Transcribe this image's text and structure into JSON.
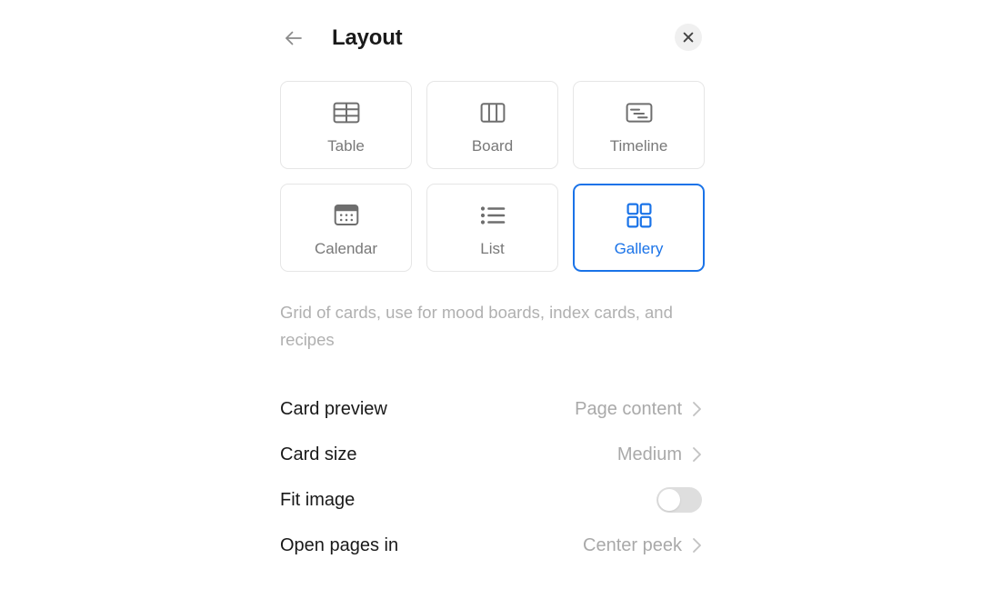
{
  "header": {
    "title": "Layout",
    "back_icon": "arrow-left-icon",
    "close_icon": "close-icon"
  },
  "layout_options": [
    {
      "label": "Table",
      "icon": "table-icon",
      "selected": false
    },
    {
      "label": "Board",
      "icon": "board-icon",
      "selected": false
    },
    {
      "label": "Timeline",
      "icon": "timeline-icon",
      "selected": false
    },
    {
      "label": "Calendar",
      "icon": "calendar-icon",
      "selected": false
    },
    {
      "label": "List",
      "icon": "list-icon",
      "selected": false
    },
    {
      "label": "Gallery",
      "icon": "gallery-icon",
      "selected": true
    }
  ],
  "description": "Grid of cards, use for mood boards, index cards, and recipes",
  "settings": [
    {
      "label": "Card preview",
      "value": "Page content",
      "type": "chevron"
    },
    {
      "label": "Card size",
      "value": "Medium",
      "type": "chevron"
    },
    {
      "label": "Fit image",
      "value": "off",
      "type": "toggle"
    },
    {
      "label": "Open pages in",
      "value": "Center peek",
      "type": "chevron"
    }
  ],
  "colors": {
    "accent": "#1a73e8",
    "label": "#191919",
    "value": "#a9a9a9",
    "muted": "#b0b0b0",
    "icon": "#6e6e6e",
    "border": "#e6e6e6",
    "toggle_off": "#dedede"
  }
}
